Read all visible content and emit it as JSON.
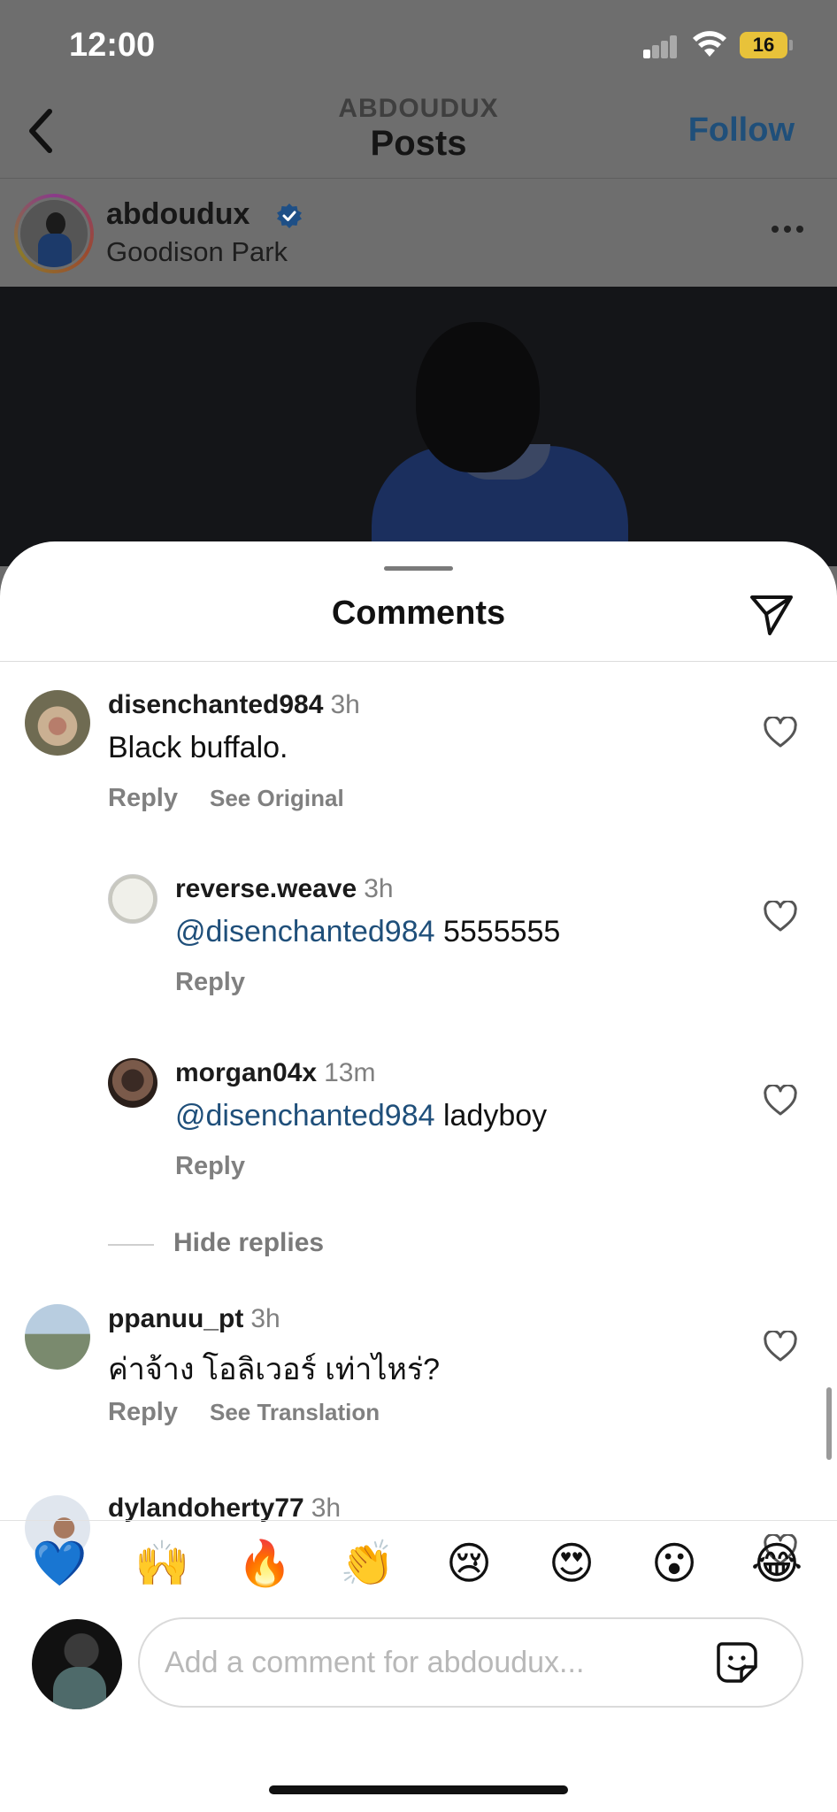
{
  "status_bar": {
    "time": "12:00",
    "battery": "16"
  },
  "nav": {
    "account": "ABDOUDUX",
    "title": "Posts",
    "follow_label": "Follow"
  },
  "post": {
    "username": "abdoudux",
    "location": "Goodison Park"
  },
  "sheet": {
    "title": "Comments"
  },
  "comments": [
    {
      "username": "disenchanted984",
      "time": "3h",
      "text": "Black buffalo.",
      "mention": "",
      "actions": [
        "Reply",
        "See Original"
      ]
    },
    {
      "username": "reverse.weave",
      "time": "3h",
      "mention": "@disenchanted984",
      "text": "5555555",
      "actions": [
        "Reply"
      ]
    },
    {
      "username": "morgan04x",
      "time": "13m",
      "mention": "@disenchanted984",
      "text": "ladyboy",
      "actions": [
        "Reply"
      ]
    },
    {
      "username": "ppanuu_pt",
      "time": "3h",
      "text": "ค่าจ้าง โอลิเวอร์ เท่าไหร่?",
      "mention": "",
      "actions": [
        "Reply",
        "See Translation"
      ]
    },
    {
      "username": "dylandoherty77",
      "time": "3h",
      "text": "",
      "mention": "",
      "actions": []
    }
  ],
  "hide_replies_label": "Hide replies",
  "reactions": [
    "💙",
    "🙌",
    "🔥",
    "👏",
    "😢",
    "😍",
    "😮",
    "😂"
  ],
  "composer": {
    "placeholder": "Add a comment for abdoudux..."
  },
  "colors": {
    "link": "#1f4f7a",
    "muted": "#808080",
    "follow": "#1f4f7a"
  },
  "icons": [
    "back-chevron-icon",
    "verified-badge-icon",
    "more-icon",
    "send-icon",
    "heart-icon",
    "sticker-icon"
  ]
}
